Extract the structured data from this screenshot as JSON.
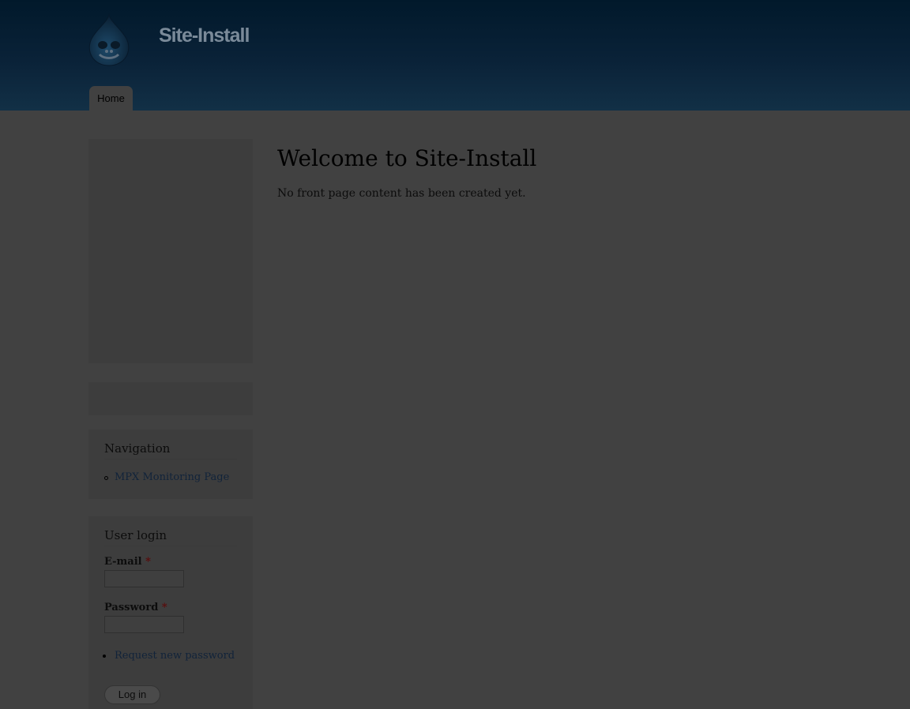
{
  "header": {
    "site_name": "Site-Install",
    "logo_icon": "drupal-drop-icon",
    "tabs": [
      {
        "label": "Home"
      }
    ]
  },
  "main": {
    "title": "Welcome to Site-Install",
    "message": "No front page content has been created yet."
  },
  "sidebar": {
    "navigation": {
      "title": "Navigation",
      "items": [
        {
          "label": "MPX Monitoring Page"
        }
      ]
    },
    "user_login": {
      "title": "User login",
      "email_label": "E-mail",
      "password_label": "Password",
      "required_marker": "*",
      "email_value": "",
      "password_value": "",
      "links": [
        {
          "label": "Request new password"
        }
      ],
      "submit_label": "Log in"
    }
  },
  "colors": {
    "overlay_background": "#414141",
    "header_top": "#01192b",
    "header_bottom": "#123046",
    "required": "#5a0b0b"
  }
}
